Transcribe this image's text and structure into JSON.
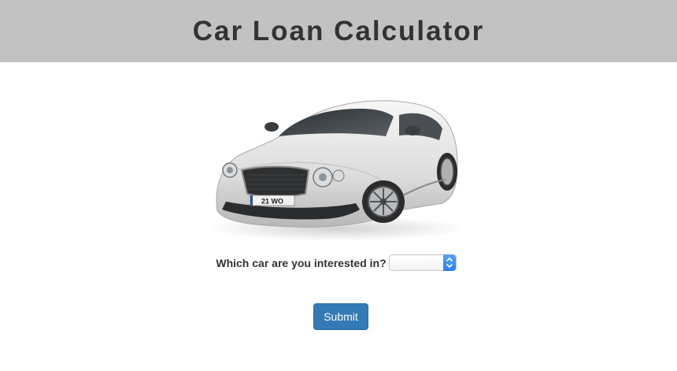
{
  "header": {
    "title": "Car Loan Calculator"
  },
  "car_image": {
    "plate_text": "21 WO"
  },
  "form": {
    "question_label": "Which car are you interested in?",
    "car_select_value": "",
    "submit_label": "Submit"
  },
  "colors": {
    "header_bg": "#c2c2c2",
    "title_text": "#333333",
    "button_bg": "#337ab7",
    "select_arrow": "#2a7ff0"
  }
}
